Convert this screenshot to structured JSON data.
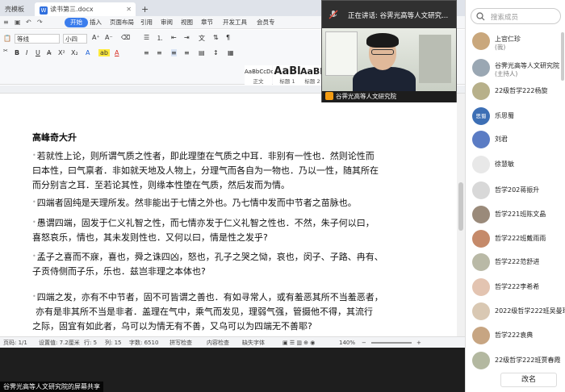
{
  "tabs": {
    "left_tab": "壳模板",
    "doc_tab": "读书第三.docx",
    "plus": "+"
  },
  "menu": {
    "items": [
      "开始",
      "插入",
      "页面布局",
      "引用",
      "审阅",
      "视图",
      "章节",
      "开发工具",
      "会员专"
    ]
  },
  "ribbon": {
    "font_name": "等线",
    "font_size": "小四",
    "style_previews": [
      {
        "preview": "AaBbCcDd",
        "name": "正文"
      },
      {
        "preview": "AaBl",
        "name": "标题 1"
      },
      {
        "preview": "AaBb",
        "name": "标题 2"
      }
    ]
  },
  "document": {
    "title": "高峰奇大升",
    "paragraphs": [
      [
        "若就性上论，则所谓气质之性者，即此理堕在气质之中耳．非别有一性也．然则论性而",
        "曰本性，曰气禀者．非如就天地及人物上，分理气而各自为一物也．乃以一性，随其所在",
        "而分别言之耳．至若论其性，则缘本性堕在气质，然后发而为情。"
      ],
      [
        "四端者固纯是天理所发。然非能出于七情之外也。乃七情中发而中节者之苗脉也。"
      ],
      [
        "愚谓四端，固发于仁义礼智之性，而七情亦发于仁义礼智之性也．不然，朱子何以曰，",
        "喜怒哀乐，情也，其未发则性也．又何以曰，情是性之发乎?"
      ],
      [
        "孟子之喜而不寐，喜也，舜之诛四凶，怒也，孔子之哭之恸，哀也，闵子、子路、冉有、",
        "子贡侍侧而子乐，乐也．兹岂非理之本体也?"
      ],
      [
        "四端之发，亦有不中节者，固不可皆谓之善也．有如寻常人，或有羞恶其所不当羞恶者，",
        "亦有是非其所不当是非者．盖理在气中，乘气而发见，理弱气强，管摄他不得，其流行",
        "之际，固宜有如此者，乌可以为情无有不善，又乌可以为四端无不善耶?"
      ]
    ]
  },
  "statusbar": {
    "page": "页码: 1/1",
    "setting": "设置值: 7.2厘米",
    "row": "行: 5",
    "col": "列: 15",
    "words": "字数: 6510",
    "spell": "拼写检查",
    "proof": "内容检查",
    "missing_font": "缺失字体",
    "zoom": "140%"
  },
  "share_label": "谷霁光高等人文研究院的屏幕共享",
  "video": {
    "speaking_prefix": "正在讲话:",
    "speaker": "谷霁光高等人文研究...",
    "name_tag": "谷霁光高等人文研究院"
  },
  "members_panel": {
    "search_placeholder": "搜索成员",
    "members": [
      {
        "name": "上官仁珍",
        "sub": "(我)",
        "avatar_color": "#c9a77c"
      },
      {
        "name": "谷霁光高等人文研究院",
        "sub": "(主持人)",
        "avatar_color": "#9aa7b3"
      },
      {
        "name": "22级哲学222杨旋",
        "sub": "",
        "avatar_color": "#b7b08a"
      },
      {
        "name": "乐思蜀",
        "sub": "",
        "avatar_color": "#3d6fb5",
        "avatar_text": "思蜀"
      },
      {
        "name": "刘君",
        "sub": "",
        "avatar_color": "#5b7cc4"
      },
      {
        "name": "徐慧敏",
        "sub": "",
        "avatar_color": "#e8e8e8"
      },
      {
        "name": "哲学202蒋振升",
        "sub": "",
        "avatar_color": "#d8d8d8"
      },
      {
        "name": "哲学221班陈文晶",
        "sub": "",
        "avatar_color": "#9a8a7a"
      },
      {
        "name": "哲学222班戴雨雨",
        "sub": "",
        "avatar_color": "#c58a6a"
      },
      {
        "name": "哲学222范舒进",
        "sub": "",
        "avatar_color": "#b9b9a6"
      },
      {
        "name": "哲学222李希希",
        "sub": "",
        "avatar_color": "#e3c4b1"
      },
      {
        "name": "2022级哲学222班吴曼珍",
        "sub": "",
        "avatar_color": "#d9c8b3"
      },
      {
        "name": "哲学222袁典",
        "sub": "",
        "avatar_color": "#c7a582"
      },
      {
        "name": "22级哲学222班贾春霞",
        "sub": "",
        "avatar_color": "#b3b8a0"
      }
    ],
    "rename_button": "改名"
  },
  "colors": {
    "accent": "#3b7ded",
    "panel_bg": "#ffffff",
    "dark_bg": "#2b2b2b"
  }
}
